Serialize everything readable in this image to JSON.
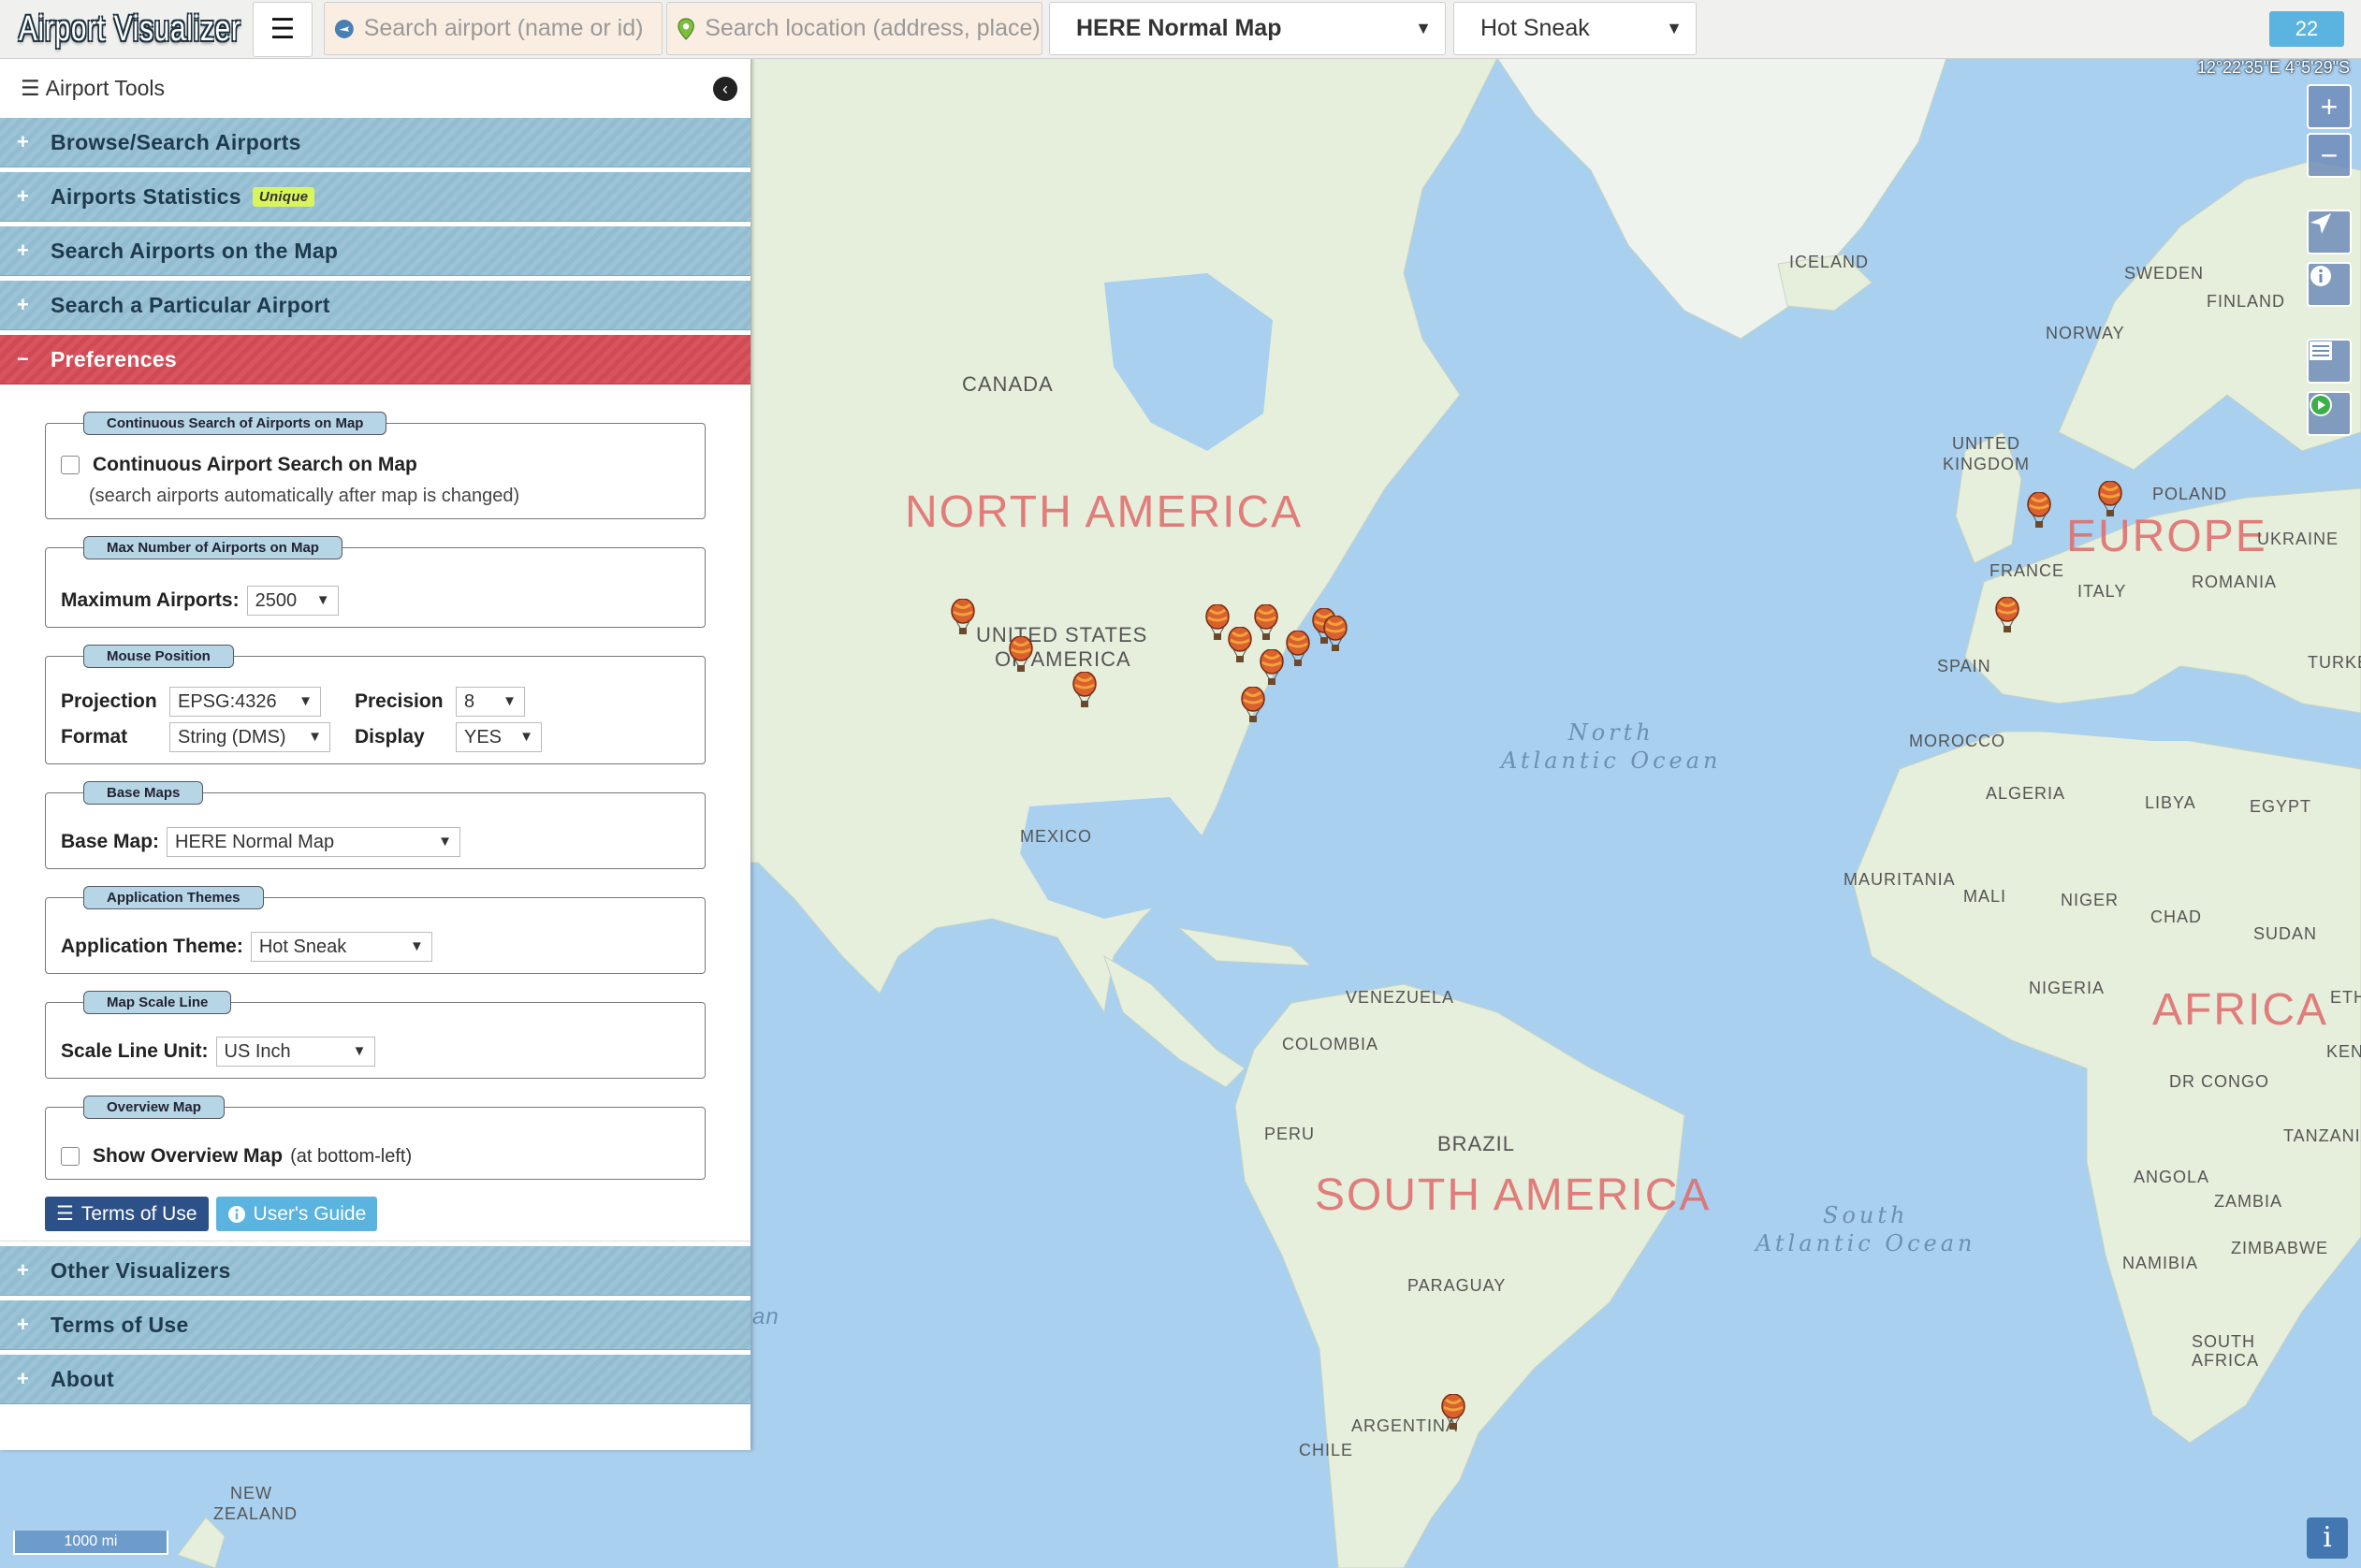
{
  "app": {
    "title": "Airport Visualizer",
    "counter": "22"
  },
  "topbar": {
    "menu_icon": "hamburger-icon",
    "search_airport_placeholder": "Search airport (name or id)",
    "search_location_placeholder": "Search location (address, place)",
    "base_map_selected": "HERE Normal Map",
    "theme_selected": "Hot Sneak"
  },
  "map": {
    "coordinates": "12°22'35\"E 4°5'29\"S",
    "scale_label": "1000 mi",
    "continents": [
      "NORTH AMERICA",
      "EUROPE",
      "SOUTH AMERICA",
      "AFRICA"
    ],
    "oceans": [
      "North Atlantic Ocean",
      "South Atlantic Ocean"
    ],
    "countries": {
      "iceland": "ICELAND",
      "canada": "CANADA",
      "usa_1": "UNITED STATES",
      "usa_2": "OF AMERICA",
      "mexico": "MEXICO",
      "venezuela": "VENEZUELA",
      "colombia": "COLOMBIA",
      "peru": "PERU",
      "brazil": "BRAZIL",
      "paraguay": "PARAGUAY",
      "argentina": "ARGENTINA",
      "chile": "CHILE",
      "uk_1": "UNITED",
      "uk_2": "KINGDOM",
      "norway": "NORWAY",
      "sweden": "SWEDEN",
      "finland": "FINLAND",
      "poland": "POLAND",
      "ukraine": "UKRAINE",
      "france": "FRANCE",
      "italy": "ITALY",
      "romania": "ROMANIA",
      "spain": "SPAIN",
      "turkey": "TURKE",
      "morocco": "MOROCCO",
      "algeria": "ALGERIA",
      "libya": "LIBYA",
      "egypt": "EGYPT",
      "mauritania": "MAURITANIA",
      "mali": "MALI",
      "niger": "NIGER",
      "chad": "CHAD",
      "sudan": "SUDAN",
      "nigeria": "NIGERIA",
      "dr_congo": "DR CONGO",
      "tanzania": "TANZANIA",
      "angola": "ANGOLA",
      "zambia": "ZAMBIA",
      "zimbabwe": "ZIMBABWE",
      "namibia": "NAMIBIA",
      "south_africa_1": "SOUTH",
      "south_africa_2": "AFRICA",
      "ethiopia": "ETH",
      "kenya": "KENY",
      "nz_1": "NEW",
      "nz_2": "ZEALAND",
      "partial_an": "an"
    },
    "controls": {
      "zoom_in": "+",
      "zoom_out": "−",
      "locate_icon": "navigation-arrow-icon",
      "info_icon": "info-circle-icon",
      "list_icon": "list-icon",
      "play_icon": "play-icon",
      "info_corner": "i"
    }
  },
  "sidebar": {
    "header": "Airport Tools",
    "header_icon": "list-icon",
    "collapse_icon": "chevron-left-icon",
    "sections": {
      "browse": "Browse/Search Airports",
      "stats": "Airports Statistics",
      "stats_tag": "Unique",
      "search_map": "Search Airports on the Map",
      "search_particular": "Search a Particular Airport",
      "preferences": "Preferences",
      "other": "Other Visualizers",
      "terms": "Terms of Use",
      "about": "About"
    },
    "prefs": {
      "continuous": {
        "legend": "Continuous Search of Airports on Map",
        "label": "Continuous Airport Search on Map",
        "note": "(search airports automatically after map is changed)",
        "checked": false
      },
      "max": {
        "legend": "Max Number of Airports on Map",
        "label": "Maximum Airports:",
        "value": "2500"
      },
      "mouse": {
        "legend": "Mouse Position",
        "projection_label": "Projection",
        "projection_value": "EPSG:4326",
        "precision_label": "Precision",
        "precision_value": "8",
        "format_label": "Format",
        "format_value": "String (DMS)",
        "display_label": "Display",
        "display_value": "YES"
      },
      "basemaps": {
        "legend": "Base Maps",
        "label": "Base Map:",
        "value": "HERE Normal Map"
      },
      "themes": {
        "legend": "Application Themes",
        "label": "Application Theme:",
        "value": "Hot Sneak"
      },
      "scale": {
        "legend": "Map Scale Line",
        "label": "Scale Line Unit:",
        "value": "US Inch"
      },
      "overview": {
        "legend": "Overview Map",
        "label": "Show Overview Map",
        "note": "(at bottom-left)",
        "checked": false
      },
      "terms_button": "Terms of Use",
      "guide_button": "User's Guide"
    }
  },
  "colors": {
    "accent_open": "#d9545f",
    "accordion": "#9cc4d6",
    "badge": "#5bb3df",
    "water": "#a9d0ef",
    "land": "#e8efe0"
  }
}
